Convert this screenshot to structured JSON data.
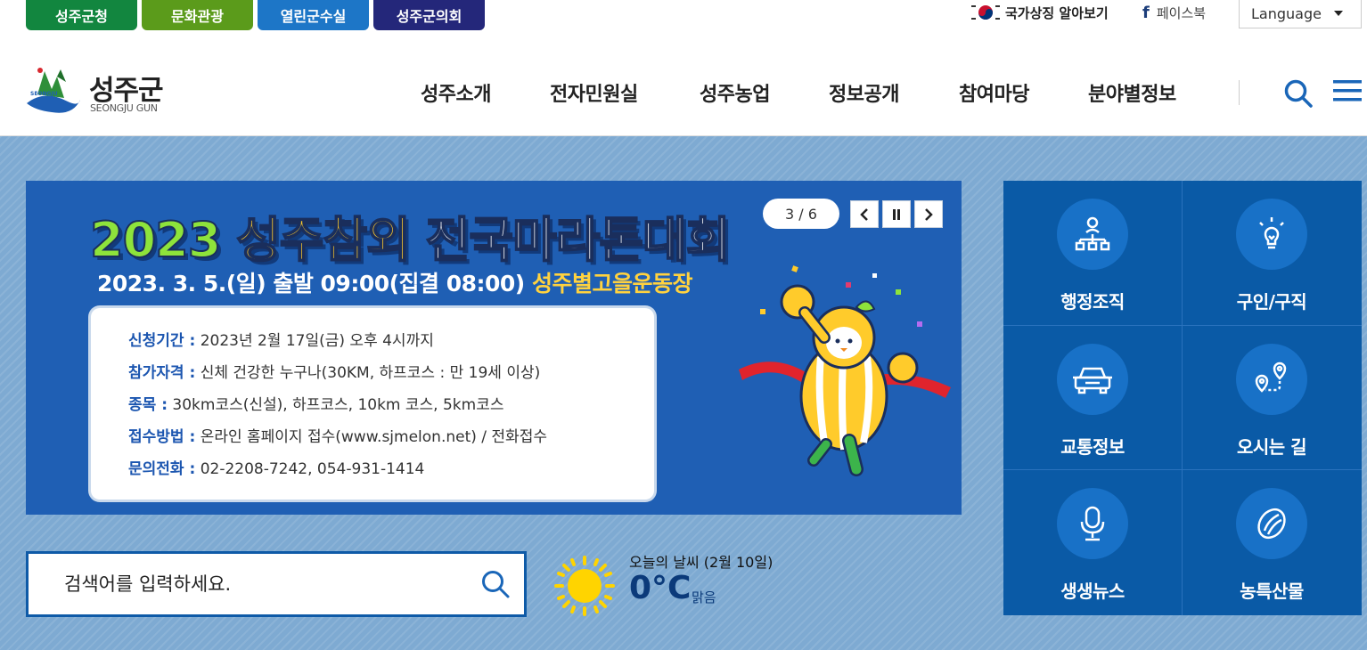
{
  "site_tabs": [
    {
      "label": "성주군청",
      "color": "#12863f"
    },
    {
      "label": "문화관광",
      "color": "#5b9b1b"
    },
    {
      "label": "열린군수실",
      "color": "#1d76c7"
    },
    {
      "label": "성주군의회",
      "color": "#24277a"
    }
  ],
  "utility": {
    "national_symbol": "국가상징 알아보기",
    "facebook": "페이스북",
    "language": "Language"
  },
  "logo": {
    "name_ko": "성주군",
    "name_en": "SEONGJU GUN",
    "emblem_text": "SEONGJU"
  },
  "gnb": [
    "성주소개",
    "전자민원실",
    "성주농업",
    "정보공개",
    "참여마당",
    "분야별정보"
  ],
  "banner": {
    "title_year": "2023",
    "title_mid": "성주참외",
    "title_end": "전국마라톤대회",
    "sub_text": "2023. 3. 5.(일) 출발 09:00(집결 08:00)",
    "sub_place": "성주별고을운동장",
    "info": [
      {
        "label": "신청기간 :",
        "value": "2023년 2월 17일(금) 오후 4시까지"
      },
      {
        "label": "참가자격 :",
        "value": "신체 건강한 누구나(30KM, 하프코스 : 만 19세 이상)"
      },
      {
        "label": "종목 :",
        "value": "30km코스(신설), 하프코스, 10km 코스, 5km코스"
      },
      {
        "label": "접수방법 :",
        "value": "온라인 홈페이지 접수(www.sjmelon.net) / 전화접수"
      },
      {
        "label": "문의전화 :",
        "value": "02-2208-7242, 054-931-1414"
      }
    ],
    "counter": "3 / 6"
  },
  "search": {
    "placeholder": "검색어를 입력하세요."
  },
  "weather": {
    "title": "오늘의 날씨 (2월 10일)",
    "temp": "0°C",
    "condition": "맑음",
    "icon": "sun-icon"
  },
  "quick_menu": [
    {
      "label": "행정조직",
      "icon": "org-chart-icon"
    },
    {
      "label": "구인/구직",
      "icon": "lightbulb-icon"
    },
    {
      "label": "교통정보",
      "icon": "car-icon"
    },
    {
      "label": "오시는 길",
      "icon": "route-icon"
    },
    {
      "label": "생생뉴스",
      "icon": "microphone-icon"
    },
    {
      "label": "농특산물",
      "icon": "melon-icon"
    }
  ],
  "colors": {
    "accent": "#0a5aa6",
    "banner_bg": "#1f5fb4",
    "content_bg": "#7eaad2"
  }
}
